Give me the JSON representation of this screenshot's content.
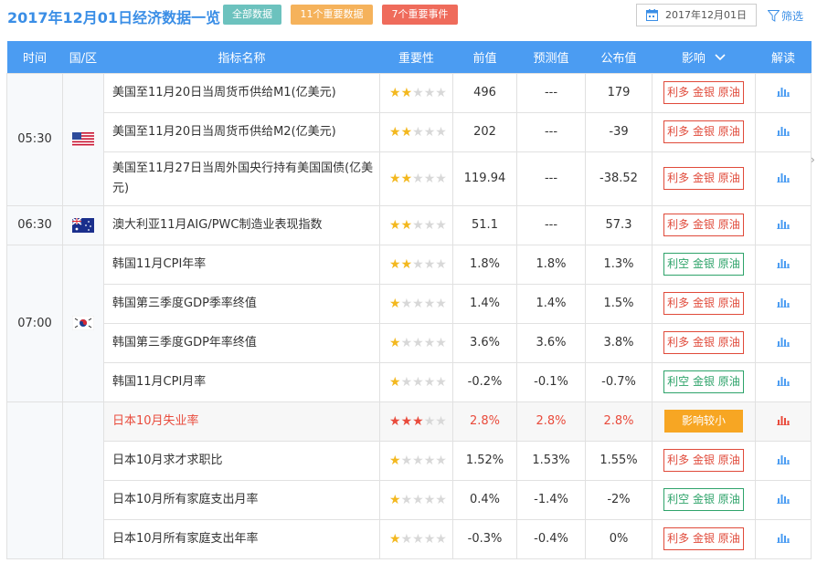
{
  "header": {
    "title": "2017年12月01日经济数据一览",
    "tags": [
      "全部数据",
      "11个重要数据",
      "7个重要事件"
    ],
    "date": "2017年12月01日",
    "filter_label": "筛选"
  },
  "columns": [
    "时间",
    "国/区",
    "指标名称",
    "重要性",
    "前值",
    "预测值",
    "公布值",
    "影响",
    "解读"
  ],
  "groups": [
    {
      "time": "05:30",
      "flag": "us-flag-icon",
      "rows": [
        {
          "name": "美国至11月20日当周货币供给M1(亿美元)",
          "stars": 2,
          "prev": "496",
          "forecast": "---",
          "actual": "179",
          "impact": "利多 金银 原油",
          "impact_type": "bull"
        },
        {
          "name": "美国至11月20日当周货币供给M2(亿美元)",
          "stars": 2,
          "prev": "202",
          "forecast": "---",
          "actual": "-39",
          "impact": "利多 金银 原油",
          "impact_type": "bull"
        },
        {
          "name": "美国至11月27日当周外国央行持有美国国债(亿美元)",
          "stars": 2,
          "prev": "119.94",
          "forecast": "---",
          "actual": "-38.52",
          "impact": "利多 金银 原油",
          "impact_type": "bull"
        }
      ]
    },
    {
      "time": "06:30",
      "flag": "au-flag-icon",
      "rows": [
        {
          "name": "澳大利亚11月AIG/PWC制造业表现指数",
          "stars": 2,
          "prev": "51.1",
          "forecast": "---",
          "actual": "57.3",
          "impact": "利多 金银 原油",
          "impact_type": "bull"
        }
      ]
    },
    {
      "time": "07:00",
      "flag": "kr-flag-icon",
      "rows": [
        {
          "name": "韩国11月CPI年率",
          "stars": 2,
          "prev": "1.8%",
          "forecast": "1.8%",
          "actual": "1.3%",
          "impact": "利空 金银 原油",
          "impact_type": "bear"
        },
        {
          "name": "韩国第三季度GDP季率终值",
          "stars": 1,
          "prev": "1.4%",
          "forecast": "1.4%",
          "actual": "1.5%",
          "impact": "利多 金银 原油",
          "impact_type": "bull"
        },
        {
          "name": "韩国第三季度GDP年率终值",
          "stars": 1,
          "prev": "3.6%",
          "forecast": "3.6%",
          "actual": "3.8%",
          "impact": "利多 金银 原油",
          "impact_type": "bull"
        },
        {
          "name": "韩国11月CPI月率",
          "stars": 1,
          "prev": "-0.2%",
          "forecast": "-0.1%",
          "actual": "-0.7%",
          "impact": "利空 金银 原油",
          "impact_type": "bear"
        }
      ]
    },
    {
      "time": "",
      "flag": "",
      "rows": [
        {
          "name": "日本10月失业率",
          "stars": 3,
          "prev": "2.8%",
          "forecast": "2.8%",
          "actual": "2.8%",
          "impact": "影响较小",
          "impact_type": "small",
          "highlight": true
        },
        {
          "name": "日本10月求才求职比",
          "stars": 1,
          "prev": "1.52%",
          "forecast": "1.53%",
          "actual": "1.55%",
          "impact": "利多 金银 原油",
          "impact_type": "bull"
        },
        {
          "name": "日本10月所有家庭支出月率",
          "stars": 1,
          "prev": "0.4%",
          "forecast": "-1.4%",
          "actual": "-2%",
          "impact": "利空 金银 原油",
          "impact_type": "bear"
        },
        {
          "name": "日本10月所有家庭支出年率",
          "stars": 1,
          "prev": "-0.3%",
          "forecast": "-0.4%",
          "actual": "0%",
          "impact": "利多 金银 原油",
          "impact_type": "bull"
        }
      ]
    }
  ],
  "colors": {
    "header_bg": "#4b9cf2",
    "bull": "#e04a3a",
    "bear": "#2ea36a",
    "small": "#f7a623",
    "star": "#f3b81f"
  },
  "icons": {
    "calendar": "calendar-icon",
    "filter": "filter-icon",
    "chart": "bar-chart-icon",
    "sort": "chevron-down-icon"
  }
}
